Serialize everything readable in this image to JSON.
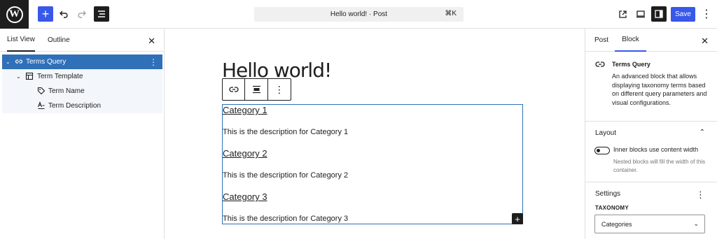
{
  "header": {
    "title": "Hello world! · Post",
    "shortcut": "⌘K",
    "save_label": "Save"
  },
  "left_panel": {
    "tabs": [
      "List View",
      "Outline"
    ],
    "items": [
      {
        "label": "Terms Query",
        "icon": "terms-query-icon"
      },
      {
        "label": "Term Template",
        "icon": "template-icon"
      },
      {
        "label": "Term Name",
        "icon": "tag-icon"
      },
      {
        "label": "Term Description",
        "icon": "description-icon"
      }
    ]
  },
  "canvas": {
    "post_title": "Hello world!",
    "categories": [
      {
        "name": "Category 1",
        "description": "This is the description for Category 1"
      },
      {
        "name": "Category 2",
        "description": "This is the description for Category 2"
      },
      {
        "name": "Category 3",
        "description": "This is the description for Category 3"
      }
    ]
  },
  "right_panel": {
    "tabs": [
      "Post",
      "Block"
    ],
    "block": {
      "title": "Terms Query",
      "description": "An advanced block that allows displaying taxonomy terms based on different query parameters and visual configurations."
    },
    "layout": {
      "title": "Layout",
      "toggle_label": "Inner blocks use content width",
      "toggle_help": "Nested blocks will fill the width of this container.",
      "toggle_on": false
    },
    "settings": {
      "title": "Settings",
      "taxonomy_label": "TAXONOMY",
      "taxonomy_value": "Categories"
    }
  },
  "colors": {
    "accent": "#3858e9",
    "selected_row": "#2f70b8",
    "dark": "#1e1e1e"
  }
}
